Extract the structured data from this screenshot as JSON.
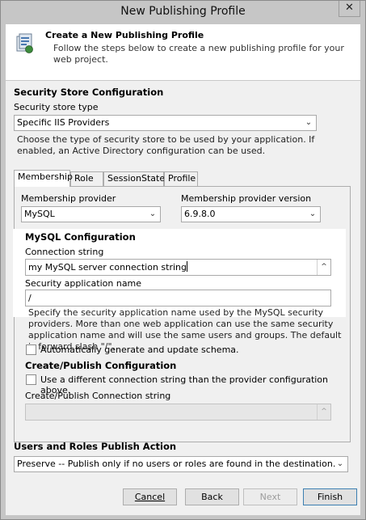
{
  "window": {
    "title": "New Publishing Profile",
    "close_glyph": "✕"
  },
  "header": {
    "title": "Create a New Publishing Profile",
    "description": "Follow the steps below to create a new publishing profile for your web project.",
    "icon": "publish-profile-icon"
  },
  "security_store": {
    "section_title": "Security Store Configuration",
    "type_label": "Security store type",
    "type_value": "Specific IIS Providers",
    "description": "Choose the type of security store to be used by your application. If enabled, an Active Directory configuration can be used."
  },
  "tabs": [
    {
      "label": "Membership",
      "active": true
    },
    {
      "label": "Role",
      "active": false
    },
    {
      "label": "SessionState",
      "active": false
    },
    {
      "label": "Profile",
      "active": false
    }
  ],
  "membership": {
    "provider_label": "Membership provider",
    "provider_value": "MySQL",
    "version_label": "Membership provider version",
    "version_value": "6.9.8.0"
  },
  "mysql_config": {
    "section_title": "MySQL Configuration",
    "connection_label": "Connection string",
    "connection_value": "my MySQL server connection string",
    "app_name_label": "Security application name",
    "app_name_value": "/",
    "app_name_description": "Specify the security application name used by the MySQL security providers. More than one web application can use the same security application name and will use the same users and groups. The default is forward slash \"/\".",
    "auto_schema_label": "Automatically generate and update schema."
  },
  "create_publish": {
    "section_title": "Create/Publish Configuration",
    "different_conn_label": "Use a different connection string than the provider configuration above.",
    "conn_label": "Create/Publish Connection string",
    "conn_value": ""
  },
  "users_roles": {
    "section_title": "Users and Roles Publish Action",
    "action_value": "Preserve -- Publish only if no users or roles are found in the destination."
  },
  "buttons": {
    "cancel": "Cancel",
    "back": "Back",
    "next": "Next",
    "finish": "Finish"
  }
}
